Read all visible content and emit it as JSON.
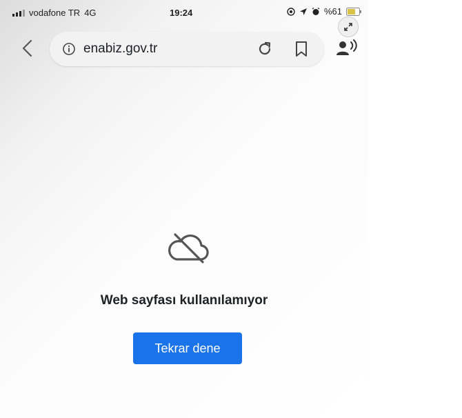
{
  "status_bar": {
    "carrier": "vodafone TR",
    "network": "4G",
    "time": "19:24",
    "battery": "%61"
  },
  "browser": {
    "url": "enabiz.gov.tr"
  },
  "error_page": {
    "message": "Web sayfası kullanılamıyor",
    "retry_label": "Tekrar dene"
  },
  "colors": {
    "accent": "#1a73e8",
    "text": "#202124"
  },
  "icons": [
    "signal-icon",
    "location-icon",
    "arrow-icon",
    "alarm-icon",
    "battery-icon",
    "expand-icon",
    "back-icon",
    "info-icon",
    "reload-icon",
    "bookmark-icon",
    "read-aloud-icon",
    "cloud-off-icon"
  ]
}
